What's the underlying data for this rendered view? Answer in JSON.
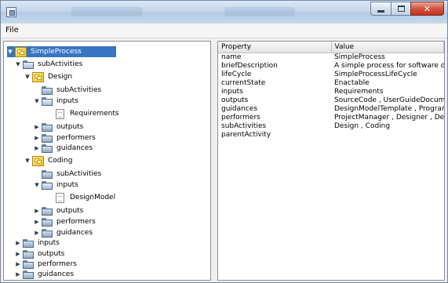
{
  "menu": {
    "file_label": "File"
  },
  "tree": {
    "root": "SimpleProcess",
    "nodes": [
      {
        "label": "subActivities",
        "icon": "folder-icon",
        "expanded": true
      },
      {
        "label": "Design",
        "icon": "process-icon",
        "expanded": true
      },
      {
        "label": "subActivities",
        "icon": "folder-icon"
      },
      {
        "label": "inputs",
        "icon": "folder-icon",
        "expanded": true
      },
      {
        "label": "Requirements",
        "icon": "document-icon"
      },
      {
        "label": "outputs",
        "icon": "folder-icon",
        "expanded": false
      },
      {
        "label": "performers",
        "icon": "folder-icon",
        "expanded": false
      },
      {
        "label": "guidances",
        "icon": "folder-icon",
        "expanded": false
      },
      {
        "label": "Coding",
        "icon": "process-icon",
        "expanded": true
      },
      {
        "label": "subActivities",
        "icon": "folder-icon"
      },
      {
        "label": "inputs",
        "icon": "folder-icon",
        "expanded": true
      },
      {
        "label": "DesignModel",
        "icon": "document-icon"
      },
      {
        "label": "outputs",
        "icon": "folder-icon",
        "expanded": false
      },
      {
        "label": "performers",
        "icon": "folder-icon",
        "expanded": false
      },
      {
        "label": "guidances",
        "icon": "folder-icon",
        "expanded": false
      },
      {
        "label": "inputs",
        "icon": "folder-icon",
        "expanded": false
      },
      {
        "label": "outputs",
        "icon": "folder-icon",
        "expanded": false
      },
      {
        "label": "performers",
        "icon": "folder-icon",
        "expanded": false
      },
      {
        "label": "guidances",
        "icon": "folder-icon",
        "expanded": false
      }
    ]
  },
  "table": {
    "headers": {
      "property": "Property",
      "value": "Value"
    },
    "rows": [
      {
        "property": "name",
        "value": "SimpleProcess"
      },
      {
        "property": "briefDescription",
        "value": "A simple process for software de..."
      },
      {
        "property": "lifeCycle",
        "value": "SimpleProcessLifeCycle"
      },
      {
        "property": "currentState",
        "value": "Enactable"
      },
      {
        "property": "inputs",
        "value": "Requirements"
      },
      {
        "property": "outputs",
        "value": "SourceCode , UserGuideDocum..."
      },
      {
        "property": "guidances",
        "value": "DesignModelTemplate , Program..."
      },
      {
        "property": "performers",
        "value": "ProjectManager , Designer , Deve..."
      },
      {
        "property": "subActivities",
        "value": "Design , Coding"
      },
      {
        "property": "parentActivity",
        "value": ""
      }
    ]
  },
  "colors": {
    "selection": "#3874c4",
    "close_button": "#c0341f"
  }
}
